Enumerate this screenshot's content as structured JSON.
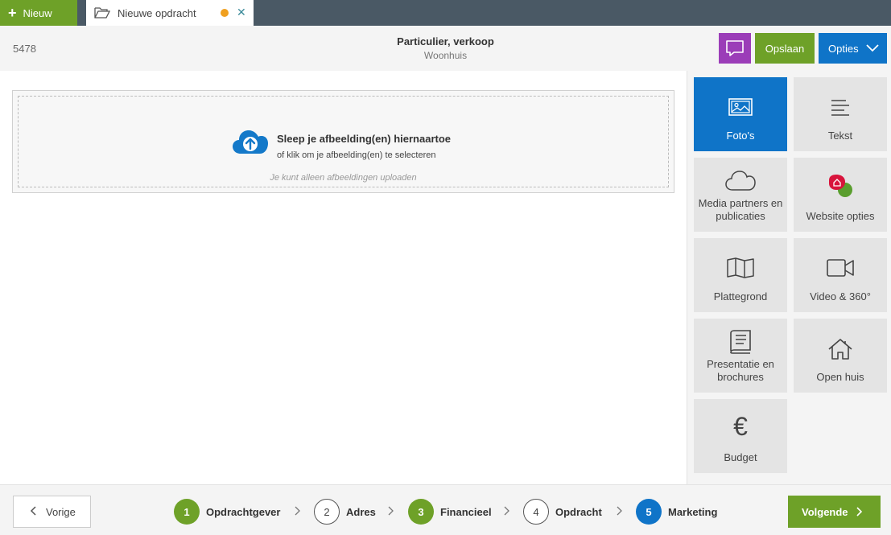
{
  "topbar": {
    "new_label": "Nieuw",
    "tab_title": "Nieuwe opdracht",
    "colors": {
      "bar": "#4a5965",
      "new": "#6ea128",
      "unsaved_dot": "#f0a020"
    }
  },
  "header": {
    "id": "5478",
    "title": "Particulier, verkoop",
    "subtitle": "Woonhuis",
    "save_label": "Opslaan",
    "options_label": "Opties"
  },
  "upload": {
    "title": "Sleep je afbeelding(en) hiernaartoe",
    "subtitle": "of klik om je afbeelding(en) te selecteren",
    "hint": "Je kunt alleen afbeeldingen uploaden"
  },
  "tiles": [
    {
      "label": "Foto's",
      "icon": "image-icon",
      "active": true
    },
    {
      "label": "Tekst",
      "icon": "text-lines-icon",
      "active": false
    },
    {
      "label": "Media partners en publicaties",
      "icon": "cloud-icon",
      "active": false
    },
    {
      "label": "Website opties",
      "icon": "website-logo-icon",
      "active": false
    },
    {
      "label": "Plattegrond",
      "icon": "map-icon",
      "active": false
    },
    {
      "label": "Video & 360°",
      "icon": "video-camera-icon",
      "active": false
    },
    {
      "label": "Presentatie en brochures",
      "icon": "book-icon",
      "active": false
    },
    {
      "label": "Open huis",
      "icon": "house-icon",
      "active": false
    },
    {
      "label": "Budget",
      "icon": "euro-icon",
      "active": false
    }
  ],
  "footer": {
    "prev_label": "Vorige",
    "next_label": "Volgende",
    "steps": [
      {
        "num": "1",
        "label": "Opdrachtgever",
        "state": "done"
      },
      {
        "num": "2",
        "label": "Adres",
        "state": "todo"
      },
      {
        "num": "3",
        "label": "Financieel",
        "state": "done"
      },
      {
        "num": "4",
        "label": "Opdracht",
        "state": "todo"
      },
      {
        "num": "5",
        "label": "Marketing",
        "state": "current"
      }
    ]
  }
}
